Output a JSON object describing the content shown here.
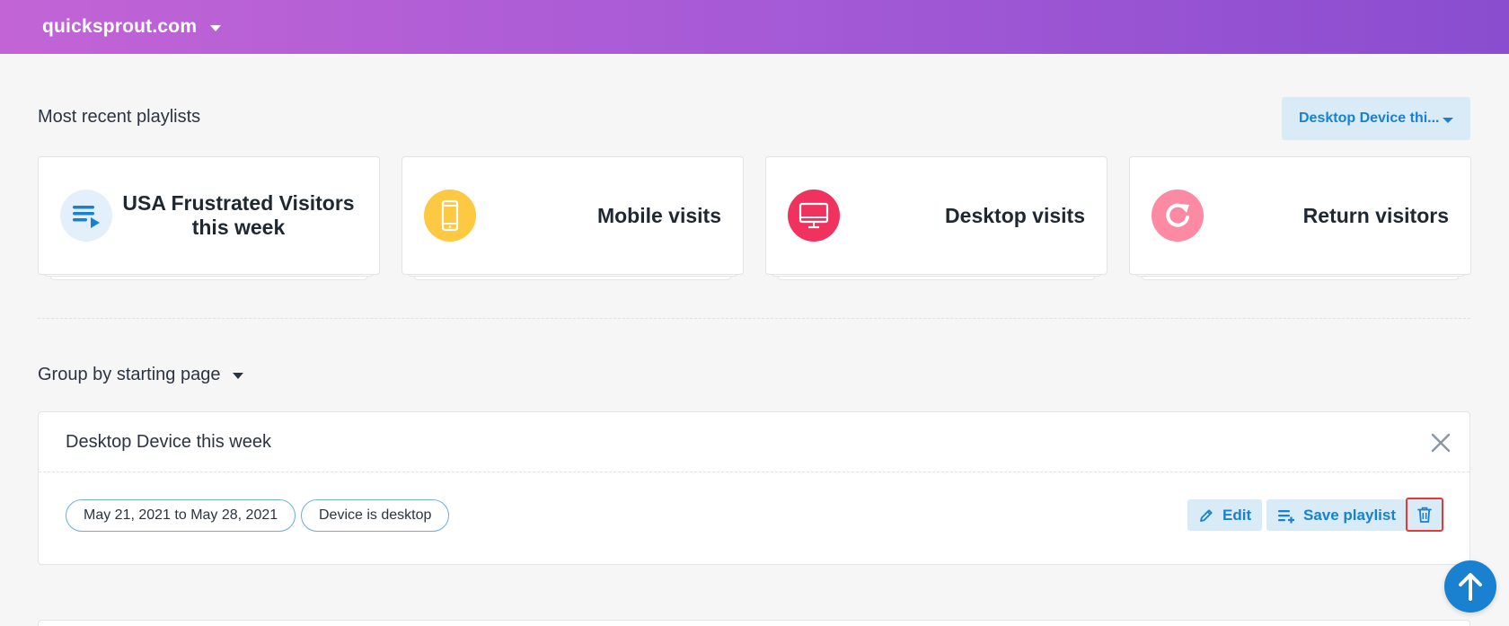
{
  "header": {
    "site": "quicksprout.com",
    "colors": {
      "gradient_start": "#c264d6",
      "gradient_end": "#8a4dcf"
    }
  },
  "playlists": {
    "title": "Most recent playlists",
    "filter_label": "Desktop Device thi...",
    "cards": [
      {
        "label": "USA Frustrated Visitors this week",
        "icon": "playlist-icon",
        "icon_bg": "#e3f0fb"
      },
      {
        "label": "Mobile visits",
        "icon": "mobile-phone-icon",
        "icon_bg": "#fdc842"
      },
      {
        "label": "Desktop visits",
        "icon": "desktop-monitor-icon",
        "icon_bg": "#f0325e"
      },
      {
        "label": "Return visitors",
        "icon": "return-arrow-icon",
        "icon_bg": "#fb8aa2"
      }
    ]
  },
  "group_by": {
    "label": "Group by starting page"
  },
  "panel": {
    "title": "Desktop Device this week",
    "chips": [
      "May 21, 2021 to May 28, 2021",
      "Device is desktop"
    ],
    "edit_label": "Edit",
    "save_label": "Save playlist"
  },
  "accent": "#1a80d0",
  "highlight": "#e53935"
}
